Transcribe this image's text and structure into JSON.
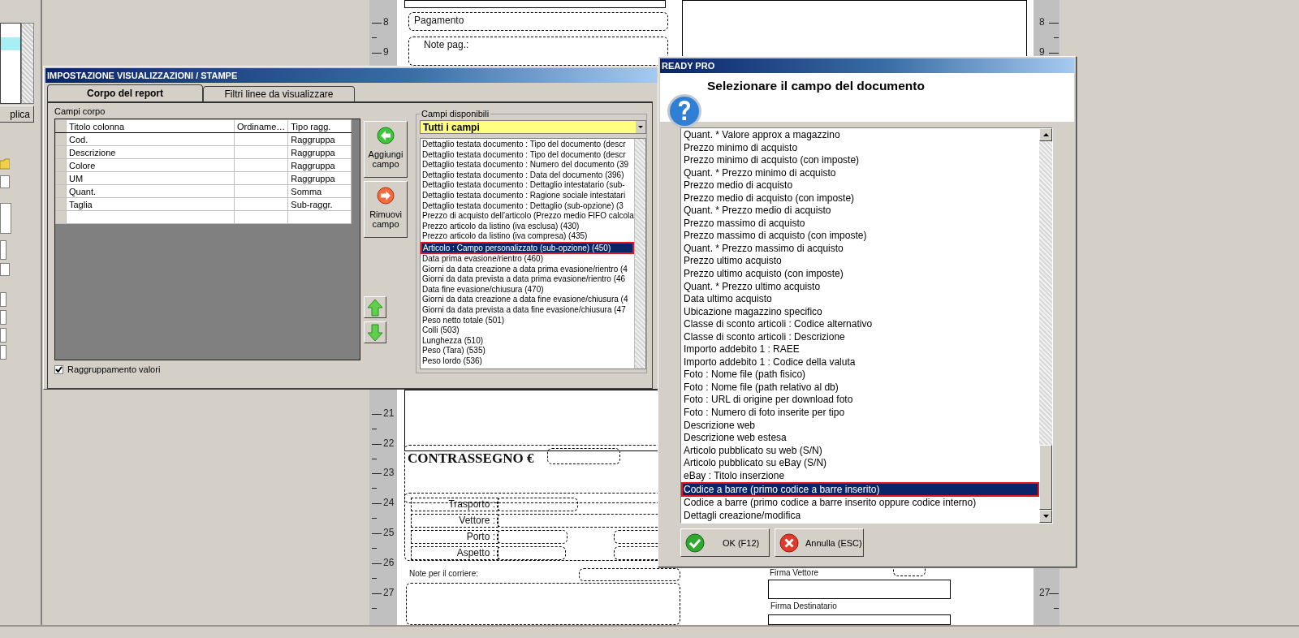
{
  "background": {
    "left_panel": {
      "button": "plica"
    },
    "ruler_left": [
      {
        "text": "8"
      },
      {
        "text": "9"
      },
      {
        "text": "21"
      },
      {
        "text": "22"
      },
      {
        "text": "23"
      },
      {
        "text": "24"
      },
      {
        "text": "25"
      },
      {
        "text": "26"
      },
      {
        "text": "27"
      }
    ],
    "ruler_right": [
      {
        "text": "8"
      },
      {
        "text": "9"
      },
      {
        "text": "27"
      }
    ],
    "form_labels": [
      {
        "text": "Pagamento",
        "kind": "label"
      },
      {
        "text": "Note pag.:",
        "kind": "label"
      },
      {
        "text": "CONTRASSEGNO €",
        "kind": "heading"
      },
      {
        "text": "Trasporto :",
        "kind": "label"
      },
      {
        "text": "Vettore :",
        "kind": "label"
      },
      {
        "text": "Porto :",
        "kind": "label"
      },
      {
        "text": "Aspetto :",
        "kind": "label"
      },
      {
        "text": "Note  per il corriere:",
        "kind": "small"
      },
      {
        "text": "Firma Vettore",
        "kind": "small"
      },
      {
        "text": "Firma Destinatario",
        "kind": "small"
      }
    ]
  },
  "settings_dialog": {
    "title": "IMPOSTAZIONE VISUALIZZAZIONI / STAMPE",
    "tabs": [
      {
        "label": "Corpo del report",
        "selected": true
      },
      {
        "label": "Filtri linee da visualizzare",
        "selected": false
      }
    ],
    "group_label": "Campi corpo",
    "grid": {
      "columns": [
        "Titolo colonna",
        "Ordiname…",
        "Tipo ragg."
      ],
      "rows": [
        {
          "title": "Cod.",
          "group_type": "Raggruppa"
        },
        {
          "title": "Descrizione",
          "group_type": "Raggruppa"
        },
        {
          "title": "Colore",
          "group_type": "Raggruppa"
        },
        {
          "title": "UM",
          "group_type": "Raggruppa"
        },
        {
          "title": "Quant.",
          "group_type": "Somma"
        },
        {
          "title": "Taglia",
          "group_type": "Sub-raggr."
        }
      ]
    },
    "add_button": {
      "line1": "Aggiungi",
      "line2": "campo"
    },
    "remove_button": {
      "line1": "Rimuovi",
      "line2": "campo"
    },
    "grouping_checkbox": {
      "label": "Raggruppamento valori",
      "checked": true
    },
    "available": {
      "label": "Campi disponibili",
      "filter": "Tutti i campi",
      "items": [
        {
          "text": "Dettaglio testata documento : Tipo del documento (descr",
          "selected": false
        },
        {
          "text": "Dettaglio testata documento : Tipo del documento (descr",
          "selected": false
        },
        {
          "text": "Dettaglio testata documento : Numero del documento (39",
          "selected": false
        },
        {
          "text": "Dettaglio testata documento : Data del documento (396)",
          "selected": false
        },
        {
          "text": "Dettaglio testata documento : Dettaglio intestatario (sub-",
          "selected": false
        },
        {
          "text": "Dettaglio testata documento : Ragione sociale intestatari",
          "selected": false
        },
        {
          "text": "Dettaglio testata documento : Dettaglio (sub-opzione) (3",
          "selected": false
        },
        {
          "text": "Prezzo di acquisto dell'articolo (Prezzo medio FIFO calcola",
          "selected": false
        },
        {
          "text": "Prezzo articolo da listino (iva esclusa) (430)",
          "selected": false
        },
        {
          "text": "Prezzo articolo da listino (iva compresa) (435)",
          "selected": false
        },
        {
          "text": "Articolo : Campo personalizzato (sub-opzione) (450)",
          "selected": true
        },
        {
          "text": "Data prima evasione/rientro (460)",
          "selected": false
        },
        {
          "text": "Giorni da data creazione a data prima evasione/rientro (4",
          "selected": false
        },
        {
          "text": "Giorni da data prevista a data prima evasione/rientro (46",
          "selected": false
        },
        {
          "text": "Data fine evasione/chiusura (470)",
          "selected": false
        },
        {
          "text": "Giorni da data creazione a data fine evasione/chiusura (4",
          "selected": false
        },
        {
          "text": "Giorni da data prevista a data fine evasione/chiusura (47",
          "selected": false
        },
        {
          "text": "Peso netto totale (501)",
          "selected": false
        },
        {
          "text": "Colli (503)",
          "selected": false
        },
        {
          "text": "Lunghezza (510)",
          "selected": false
        },
        {
          "text": "Peso (Tara) (535)",
          "selected": false
        },
        {
          "text": "Peso lordo (536)",
          "selected": false
        }
      ]
    }
  },
  "picker_dialog": {
    "title": "READY PRO",
    "message": "Selezionare il campo del documento",
    "items": [
      {
        "text": "Quant. * Valore approx a magazzino",
        "selected": false
      },
      {
        "text": "Prezzo minimo di acquisto",
        "selected": false
      },
      {
        "text": "Prezzo minimo di acquisto (con imposte)",
        "selected": false
      },
      {
        "text": "Quant. * Prezzo minimo di acquisto",
        "selected": false
      },
      {
        "text": "Prezzo medio di acquisto",
        "selected": false
      },
      {
        "text": "Prezzo medio di acquisto (con imposte)",
        "selected": false
      },
      {
        "text": "Quant. * Prezzo medio di acquisto",
        "selected": false
      },
      {
        "text": "Prezzo massimo di acquisto",
        "selected": false
      },
      {
        "text": "Prezzo massimo di acquisto (con imposte)",
        "selected": false
      },
      {
        "text": "Quant. * Prezzo massimo di acquisto",
        "selected": false
      },
      {
        "text": "Prezzo ultimo acquisto",
        "selected": false
      },
      {
        "text": "Prezzo ultimo acquisto (con imposte)",
        "selected": false
      },
      {
        "text": "Quant. * Prezzo ultimo acquisto",
        "selected": false
      },
      {
        "text": "Data ultimo acquisto",
        "selected": false
      },
      {
        "text": "Ubicazione magazzino specifico",
        "selected": false
      },
      {
        "text": "Classe di sconto articoli : Codice alternativo",
        "selected": false
      },
      {
        "text": "Classe di sconto articoli : Descrizione",
        "selected": false
      },
      {
        "text": "Importo addebito 1 : RAEE",
        "selected": false
      },
      {
        "text": "Importo addebito 1 : Codice della valuta",
        "selected": false
      },
      {
        "text": "Foto : Nome file (path fisico)",
        "selected": false
      },
      {
        "text": "Foto : Nome file (path relativo al db)",
        "selected": false
      },
      {
        "text": "Foto : URL di origine per download foto",
        "selected": false
      },
      {
        "text": "Foto : Numero di foto inserite per tipo",
        "selected": false
      },
      {
        "text": "Descrizione web",
        "selected": false
      },
      {
        "text": "Descrizione web estesa",
        "selected": false
      },
      {
        "text": "Articolo pubblicato su web (S/N)",
        "selected": false
      },
      {
        "text": "Articolo pubblicato su eBay (S/N)",
        "selected": false
      },
      {
        "text": "eBay : Titolo inserzione",
        "selected": false
      },
      {
        "text": "Codice a barre (primo codice a barre inserito)",
        "selected": true
      },
      {
        "text": "Codice a barre (primo codice a barre inserito oppure codice interno)",
        "selected": false
      },
      {
        "text": "Dettagli creazione/modifica",
        "selected": false
      }
    ],
    "buttons": [
      {
        "kind": "ok",
        "label": "OK (F12)"
      },
      {
        "kind": "cancel",
        "label": "Annulla (ESC)"
      }
    ]
  }
}
